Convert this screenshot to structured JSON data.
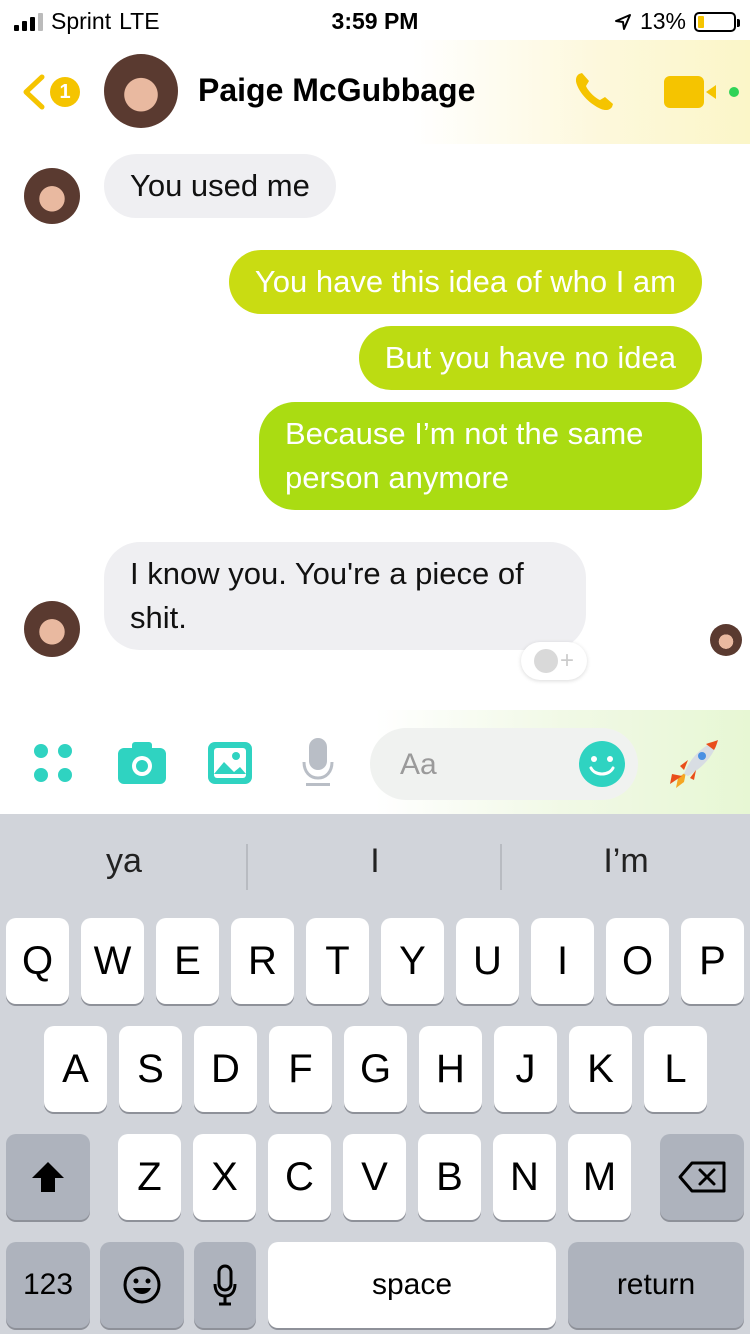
{
  "status_bar": {
    "carrier": "Sprint",
    "network": "LTE",
    "time": "3:59 PM",
    "battery": "13%",
    "battery_level": 0.13
  },
  "header": {
    "back_badge": "1",
    "contact_name": "Paige McGubbage"
  },
  "messages": [
    {
      "direction": "in",
      "text": "You used me"
    },
    {
      "direction": "out",
      "text": "You have this idea of who I am"
    },
    {
      "direction": "out",
      "text": "But you have no idea"
    },
    {
      "direction": "out",
      "text_lines": [
        "Because I’m not the same",
        "person anymore"
      ]
    },
    {
      "direction": "in",
      "text_lines": [
        "I know you. You're a piece of",
        "shit."
      ]
    }
  ],
  "composer": {
    "placeholder": "Aa"
  },
  "keyboard": {
    "suggestions": [
      "ya",
      "I",
      "I’m"
    ],
    "row1": [
      "Q",
      "W",
      "E",
      "R",
      "T",
      "Y",
      "U",
      "I",
      "O",
      "P"
    ],
    "row2": [
      "A",
      "S",
      "D",
      "F",
      "G",
      "H",
      "J",
      "K",
      "L"
    ],
    "row3": [
      "Z",
      "X",
      "C",
      "V",
      "B",
      "N",
      "M"
    ],
    "numbers_label": "123",
    "space_label": "space",
    "return_label": "return"
  },
  "colors": {
    "accent": "#f5c400",
    "bubble_out_top": "#c8dc10",
    "bubble_out_bottom": "#a6dc10",
    "composer_icon": "#2fd3c1"
  },
  "icons": {
    "back": "chevron-left-icon",
    "call": "phone-icon",
    "video": "video-camera-icon",
    "more": "apps-grid-icon",
    "camera": "camera-icon",
    "gallery": "image-icon",
    "voice": "microphone-icon",
    "emoji": "smiley-icon",
    "send": "rocket-icon",
    "shift": "shift-icon",
    "delete": "backspace-icon"
  }
}
